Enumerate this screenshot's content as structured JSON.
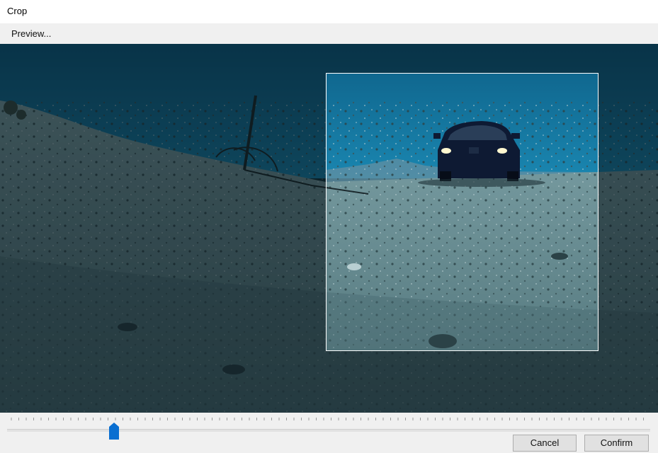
{
  "window": {
    "title": "Crop"
  },
  "menu": {
    "preview_label": "Preview..."
  },
  "video": {
    "description_icon": "video-frame",
    "selection_shown": true
  },
  "timeline": {
    "position_fraction": 0.165
  },
  "buttons": {
    "cancel_label": "Cancel",
    "confirm_label": "Confirm"
  },
  "colors": {
    "accent": "#0a6fd1",
    "crop_border": "#ffffff",
    "dim_overlay": "#061016"
  }
}
